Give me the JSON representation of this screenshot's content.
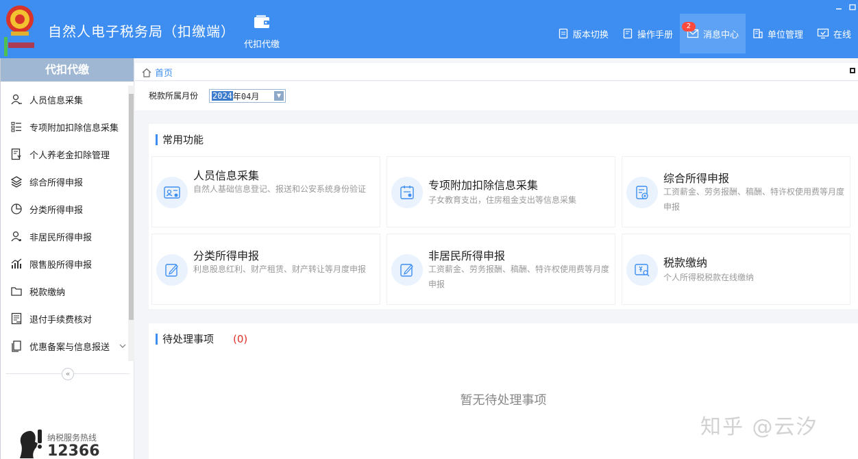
{
  "header": {
    "app_title": "自然人电子税务局（扣缴端）",
    "module_label": "代扣代缴",
    "nav": [
      {
        "label": "版本切换",
        "icon": "document-icon"
      },
      {
        "label": "操作手册",
        "icon": "manual-icon"
      },
      {
        "label": "消息中心",
        "icon": "mail-icon",
        "badge": "2"
      },
      {
        "label": "单位管理",
        "icon": "building-icon"
      },
      {
        "label": "在线",
        "icon": "monitor-check-icon"
      }
    ]
  },
  "sidebar": {
    "title": "代扣代缴",
    "items": [
      {
        "label": "人员信息采集",
        "icon": "person-icon"
      },
      {
        "label": "专项附加扣除信息采集",
        "icon": "list-icon"
      },
      {
        "label": "个人养老金扣除管理",
        "icon": "pension-doc-icon"
      },
      {
        "label": "综合所得申报",
        "icon": "layers-icon"
      },
      {
        "label": "分类所得申报",
        "icon": "pie-icon"
      },
      {
        "label": "非居民所得申报",
        "icon": "person-alt-icon"
      },
      {
        "label": "限售股所得申报",
        "icon": "bar-chart-icon"
      },
      {
        "label": "税款缴纳",
        "icon": "folder-icon"
      },
      {
        "label": "退付手续费核对",
        "icon": "receipt-icon"
      },
      {
        "label": "优惠备案与信息报送",
        "icon": "copy-icon"
      }
    ],
    "hotline_label": "纳税服务热线",
    "hotline_number": "12366"
  },
  "breadcrumb": {
    "home": "首页"
  },
  "filter": {
    "label": "税款所属月份",
    "year": "2024",
    "month_rest": "年04月"
  },
  "common": {
    "title": "常用功能",
    "cards": [
      {
        "title": "人员信息采集",
        "desc": "自然人基础信息登记、报送和公安系统身份验证",
        "icon": "id-card-icon"
      },
      {
        "title": "专项附加扣除信息采集",
        "desc": "子女教育支出，住房租金支出等信息采集",
        "icon": "calendar-form-icon"
      },
      {
        "title": "综合所得申报",
        "desc": "工资薪金、劳务报酬、稿酬、特许权使用费等月度申报",
        "icon": "report-add-icon"
      },
      {
        "title": "分类所得申报",
        "desc": "利息股息红利、财产租赁、财产转让等月度申报",
        "icon": "edit-icon"
      },
      {
        "title": "非居民所得申报",
        "desc": "工资薪金、劳务报酬、稿酬、特许权使用费等月度申报",
        "icon": "edit-icon"
      },
      {
        "title": "税款缴纳",
        "desc": "个人所得税税款在线缴纳",
        "icon": "tax-search-icon"
      }
    ]
  },
  "todo": {
    "title": "待处理事项",
    "count": "(0)",
    "empty": "暂无待处理事项"
  },
  "watermark": "知乎 @云汐",
  "colors": {
    "header": "#3d8ef0",
    "accent": "#3d8ef0",
    "badge": "#ff4a3d",
    "count": "#e0302a"
  }
}
